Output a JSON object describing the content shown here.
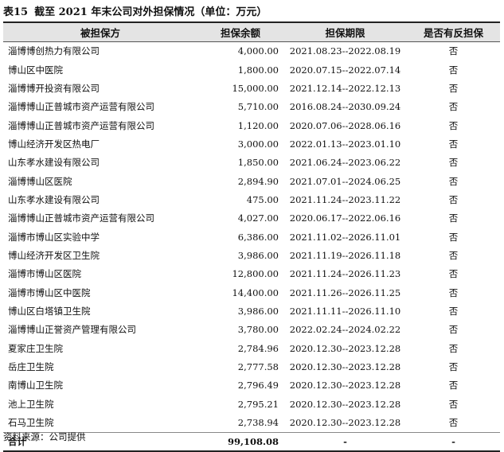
{
  "title": {
    "label": "表15",
    "text": "截至 2021 年末公司对外担保情况（单位：万元）"
  },
  "table": {
    "headers": [
      "被担保方",
      "担保余额",
      "担保期限",
      "是否有反担保"
    ],
    "rows": [
      [
        "淄博博创热力有限公司",
        "4,000.00",
        "2021.08.23--2022.08.19",
        "否"
      ],
      [
        "博山区中医院",
        "1,800.00",
        "2020.07.15--2022.07.14",
        "否"
      ],
      [
        "淄博博开投资有限公司",
        "15,000.00",
        "2021.12.14--2022.12.13",
        "否"
      ],
      [
        "淄博博山正普城市资产运营有限公司",
        "5,710.00",
        "2016.08.24--2030.09.24",
        "否"
      ],
      [
        "淄博博山正普城市资产运营有限公司",
        "1,120.00",
        "2020.07.06--2028.06.16",
        "否"
      ],
      [
        "博山经济开发区热电厂",
        "3,000.00",
        "2022.01.13--2023.01.10",
        "否"
      ],
      [
        "山东孝水建设有限公司",
        "1,850.00",
        "2021.06.24--2023.06.22",
        "否"
      ],
      [
        "淄博博山区医院",
        "2,894.90",
        "2021.07.01--2024.06.25",
        "否"
      ],
      [
        "山东孝水建设有限公司",
        "475.00",
        "2021.11.24--2023.11.22",
        "否"
      ],
      [
        "淄博博山正普城市资产运营有限公司",
        "4,027.00",
        "2020.06.17--2022.06.16",
        "否"
      ],
      [
        "淄博市博山区实验中学",
        "6,386.00",
        "2021.11.02--2026.11.01",
        "否"
      ],
      [
        "博山经济开发区卫生院",
        "3,986.00",
        "2021.11.19--2026.11.18",
        "否"
      ],
      [
        "淄博市博山区医院",
        "12,800.00",
        "2021.11.24--2026.11.23",
        "否"
      ],
      [
        "淄博市博山区中医院",
        "14,400.00",
        "2021.11.26--2026.11.25",
        "否"
      ],
      [
        "博山区白塔镇卫生院",
        "3,986.00",
        "2021.11.11--2026.11.10",
        "否"
      ],
      [
        "淄博博山正誉资产管理有限公司",
        "3,780.00",
        "2022.02.24--2024.02.22",
        "否"
      ],
      [
        "夏家庄卫生院",
        "2,784.96",
        "2020.12.30--2023.12.28",
        "否"
      ],
      [
        "岳庄卫生院",
        "2,777.58",
        "2020.12.30--2023.12.28",
        "否"
      ],
      [
        "南博山卫生院",
        "2,796.49",
        "2020.12.30--2023.12.28",
        "否"
      ],
      [
        "池上卫生院",
        "2,795.21",
        "2020.12.30--2023.12.28",
        "否"
      ],
      [
        "石马卫生院",
        "2,738.94",
        "2020.12.30--2023.12.28",
        "否"
      ]
    ],
    "total": [
      "合计",
      "99,108.08",
      "-",
      "-"
    ]
  },
  "source": "资料来源：公司提供"
}
